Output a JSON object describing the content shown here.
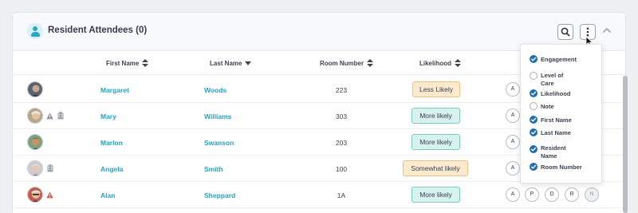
{
  "panel": {
    "title": "Resident Attendees (0)",
    "icons": {
      "header": "person-icon",
      "search": "search-icon",
      "more": "more-vertical-icon",
      "collapse": "chevron-up-icon"
    }
  },
  "table": {
    "columns": [
      {
        "label": "First Name",
        "sort": "both"
      },
      {
        "label": "Last Name",
        "sort": "descending"
      },
      {
        "label": "Room Number",
        "sort": "both"
      },
      {
        "label": "Likelihood",
        "sort": "both"
      }
    ],
    "rows": [
      {
        "first_name": "Margaret",
        "last_name": "Woods",
        "room": "223",
        "likelihood": "Less Likely",
        "likelihood_style": "orange",
        "alert": false,
        "building": false
      },
      {
        "first_name": "Mary",
        "last_name": "Williams",
        "room": "303",
        "likelihood": "More likely",
        "likelihood_style": "blue",
        "alert": true,
        "building": true
      },
      {
        "first_name": "Marlon",
        "last_name": "Swanson",
        "room": "203",
        "likelihood": "More likely",
        "likelihood_style": "blue",
        "alert": false,
        "building": false
      },
      {
        "first_name": "Angela",
        "last_name": "Smith",
        "room": "100",
        "likelihood": "Somewhat likely",
        "likelihood_style": "orange",
        "alert": false,
        "building": true
      },
      {
        "first_name": "Alan",
        "last_name": "Sheppard",
        "room": "1A",
        "likelihood": "More likely",
        "likelihood_style": "blue",
        "alert": true,
        "building": false
      }
    ],
    "attendance_buttons": [
      "A",
      "P",
      "D",
      "R",
      "N"
    ]
  },
  "column_menu": {
    "items": [
      {
        "label": "Engagement",
        "checked": true
      },
      {
        "label": "Level of Care",
        "checked": false
      },
      {
        "label": "Likelihood",
        "checked": true
      },
      {
        "label": "Note",
        "checked": false
      },
      {
        "label": "First Name",
        "checked": true
      },
      {
        "label": "Last Name",
        "checked": true
      },
      {
        "label": "Resident Name",
        "checked": true
      },
      {
        "label": "Room Number",
        "checked": true
      }
    ]
  },
  "colors": {
    "link": "#24a3c4",
    "check": "#1f6fb2",
    "pill_blue_bg": "#d8f2f0",
    "pill_orange_bg": "#fbeacd",
    "alert": "#e25547"
  }
}
